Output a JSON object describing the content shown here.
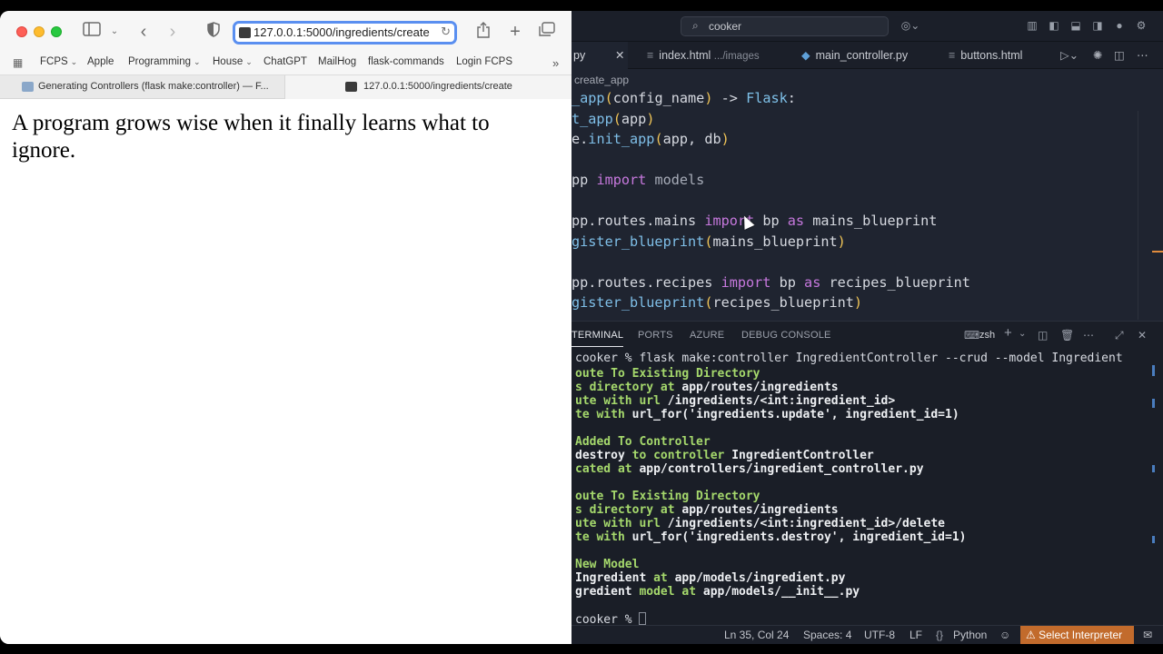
{
  "browser": {
    "url": "127.0.0.1:5000/ingredients/create",
    "bookmarks": [
      "FCPS",
      "Apple",
      "Programming",
      "House",
      "ChatGPT",
      "MailHog",
      "flask-commands",
      "Login FCPS"
    ],
    "tabs": [
      {
        "label": "Generating Controllers (flask make:controller) — F..."
      },
      {
        "label": "127.0.0.1:5000/ingredients/create"
      }
    ],
    "content": "A program grows wise when it finally learns what to ignore."
  },
  "editor": {
    "command_center": "cooker",
    "tabs": [
      {
        "label": "py",
        "active": true
      },
      {
        "label": "index.html",
        "hint": ".../images"
      },
      {
        "label": "main_controller.py"
      },
      {
        "label": "buttons.html"
      }
    ],
    "breadcrumb": "create_app",
    "code_lines": [
      "_app(config_name) -> Flask:",
      "t_app(app)",
      "e.init_app(app, db)",
      "",
      "pp import models",
      "",
      "pp.routes.mains import bp as mains_blueprint",
      "gister_blueprint(mains_blueprint)",
      "",
      "pp.routes.recipes import bp as recipes_blueprint",
      "gister_blueprint(recipes_blueprint)"
    ]
  },
  "panel": {
    "tabs": [
      "TERMINAL",
      "PORTS",
      "AZURE",
      "DEBUG CONSOLE"
    ],
    "shell": "zsh",
    "terminal": {
      "prompt_cmd": "cooker % flask make:controller IngredientController --crud --model Ingredient",
      "l1": "oute To Existing Directory",
      "l2a": "s directory at ",
      "l2b": "app/routes/ingredients",
      "l3a": "ute with url ",
      "l3b": "/ingredients/<int:ingredient_id>",
      "l4a": "te with ",
      "l4b": "url_for('ingredients.update', ingredient_id=1)",
      "l5": "Added To Controller",
      "l6a": "destroy",
      "l6b": " to controller ",
      "l6c": "IngredientController",
      "l7a": "cated at ",
      "l7b": "app/controllers/ingredient_controller.py",
      "l8": "oute To Existing Directory",
      "l9a": "s directory at ",
      "l9b": "app/routes/ingredients",
      "l10a": "ute with url ",
      "l10b": "/ingredients/<int:ingredient_id>/delete",
      "l11a": "te with ",
      "l11b": "url_for('ingredients.destroy', ingredient_id=1)",
      "l12": "New Model",
      "l13a": "Ingredient",
      "l13b": " at ",
      "l13c": "app/models/ingredient.py",
      "l14a": "gredient",
      "l14b": " model at ",
      "l14c": "app/models/__init__.py",
      "prompt_end": "cooker % "
    }
  },
  "statusbar": {
    "position": "Ln 35, Col 24",
    "spaces": "Spaces: 4",
    "encoding": "UTF-8",
    "eol": "LF",
    "language": "Python",
    "interpreter": "Select Interpreter"
  }
}
